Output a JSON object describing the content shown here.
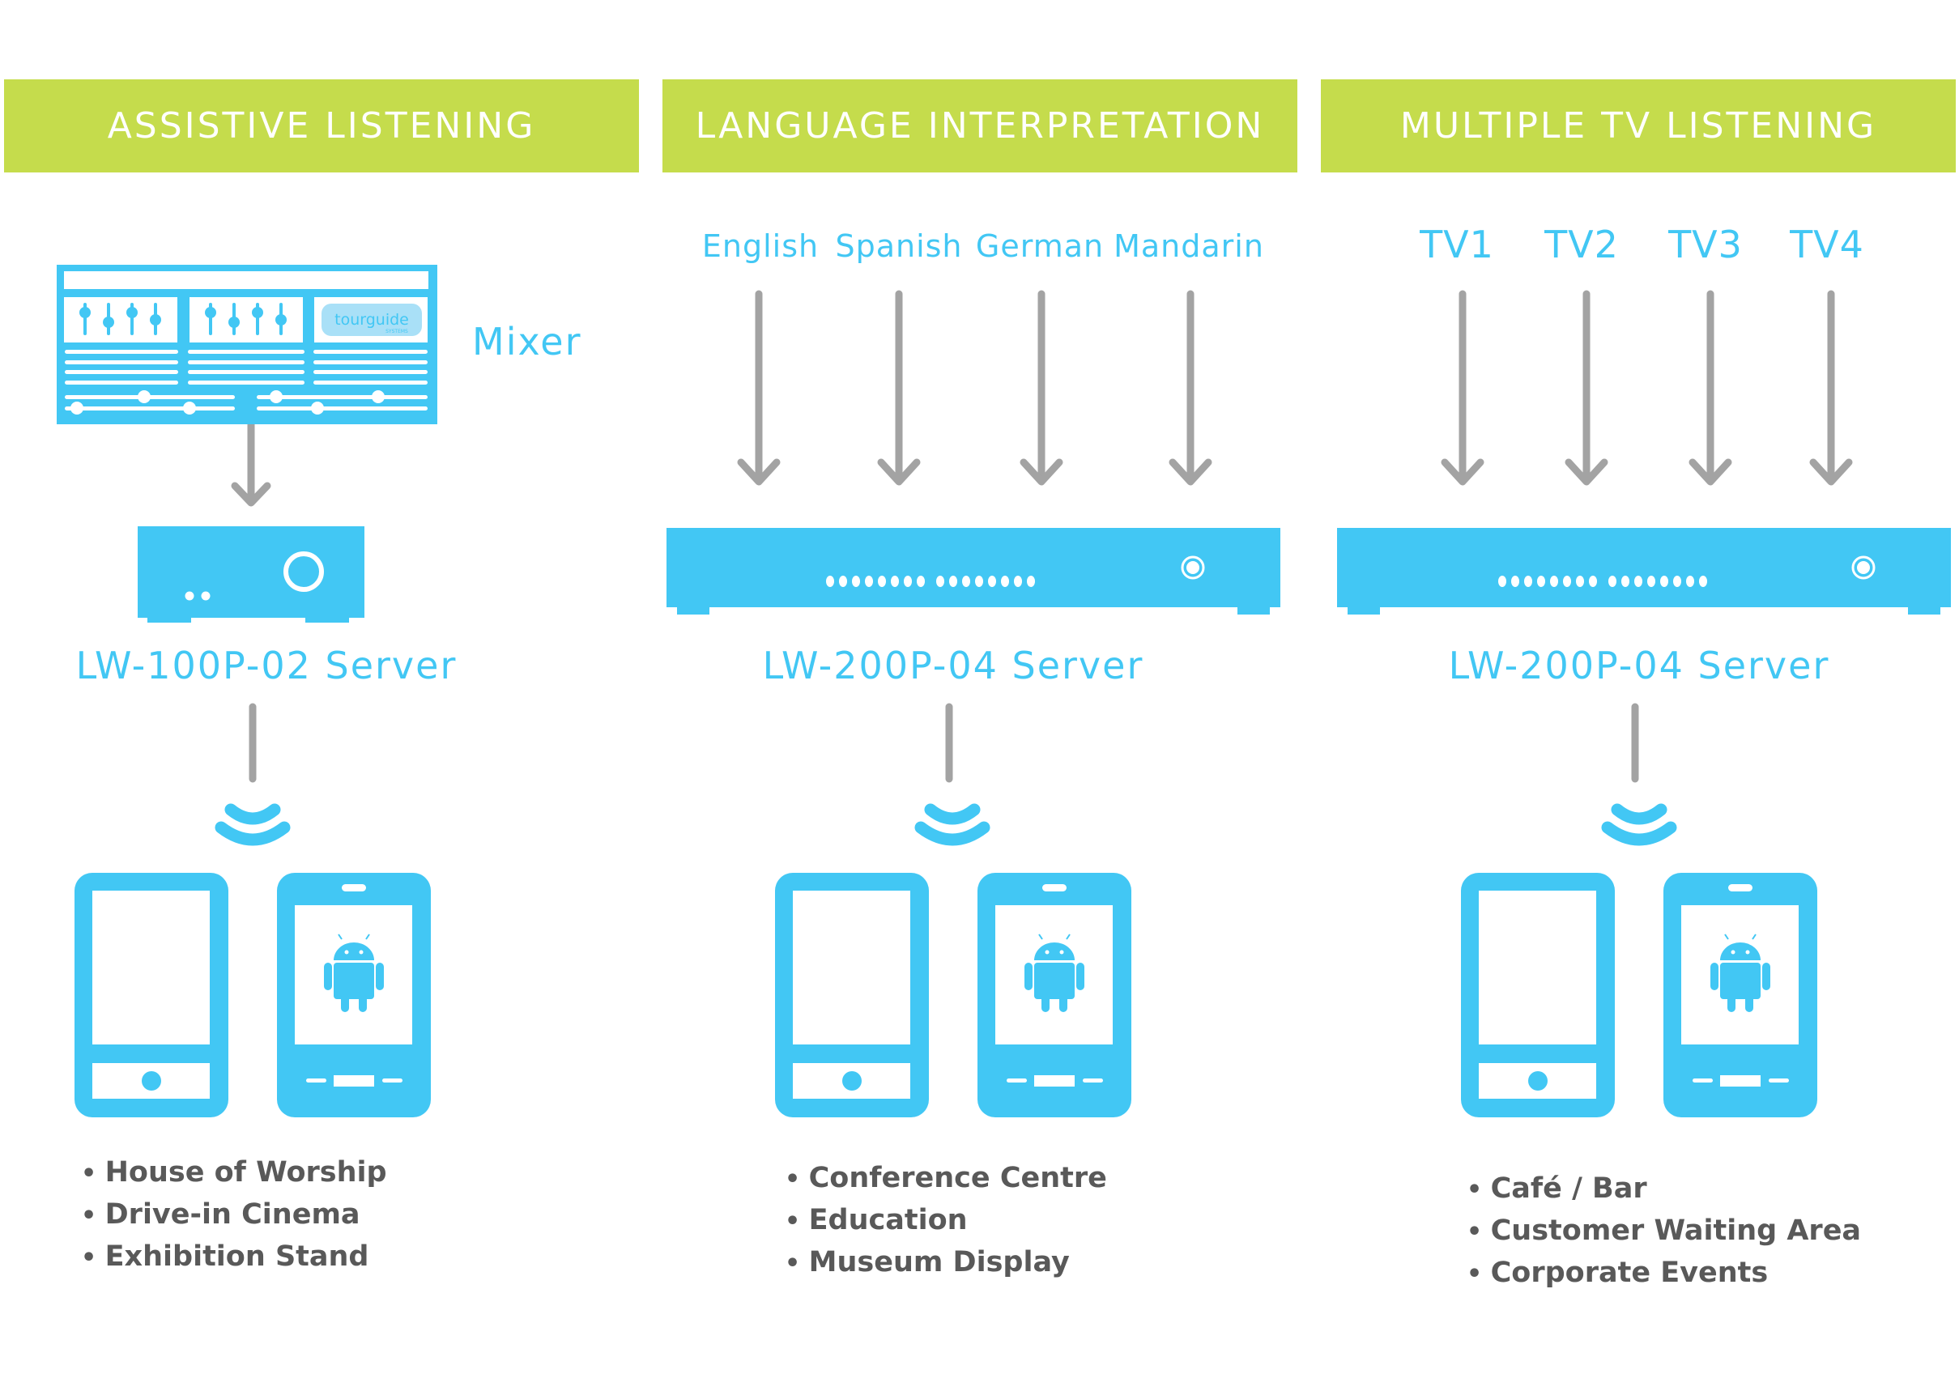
{
  "colors": {
    "accent_blue": "#42c7f4",
    "banner_green": "#c5dc4c",
    "arrow_gray": "#a3a3a3",
    "text_gray": "#595959"
  },
  "sections": [
    {
      "title": "ASSISTIVE LISTENING",
      "source_label": "Mixer",
      "mixer_logo": {
        "brand": "tourguide",
        "sub": "SYSTEMS"
      },
      "server": "LW-100P-02 Server",
      "uses": [
        "House of Worship",
        "Drive-in Cinema",
        "Exhibition Stand"
      ]
    },
    {
      "title": "LANGUAGE INTERPRETATION",
      "sources": [
        "English",
        "Spanish",
        "German",
        "Mandarin"
      ],
      "server": "LW-200P-04 Server",
      "uses": [
        "Conference Centre",
        "Education",
        "Museum Display"
      ]
    },
    {
      "title": "MULTIPLE TV LISTENING",
      "sources": [
        "TV1",
        "TV2",
        "TV3",
        "TV4"
      ],
      "server": "LW-200P-04 Server",
      "uses": [
        "Café / Bar",
        "Customer Waiting Area",
        "Corporate Events"
      ]
    }
  ]
}
